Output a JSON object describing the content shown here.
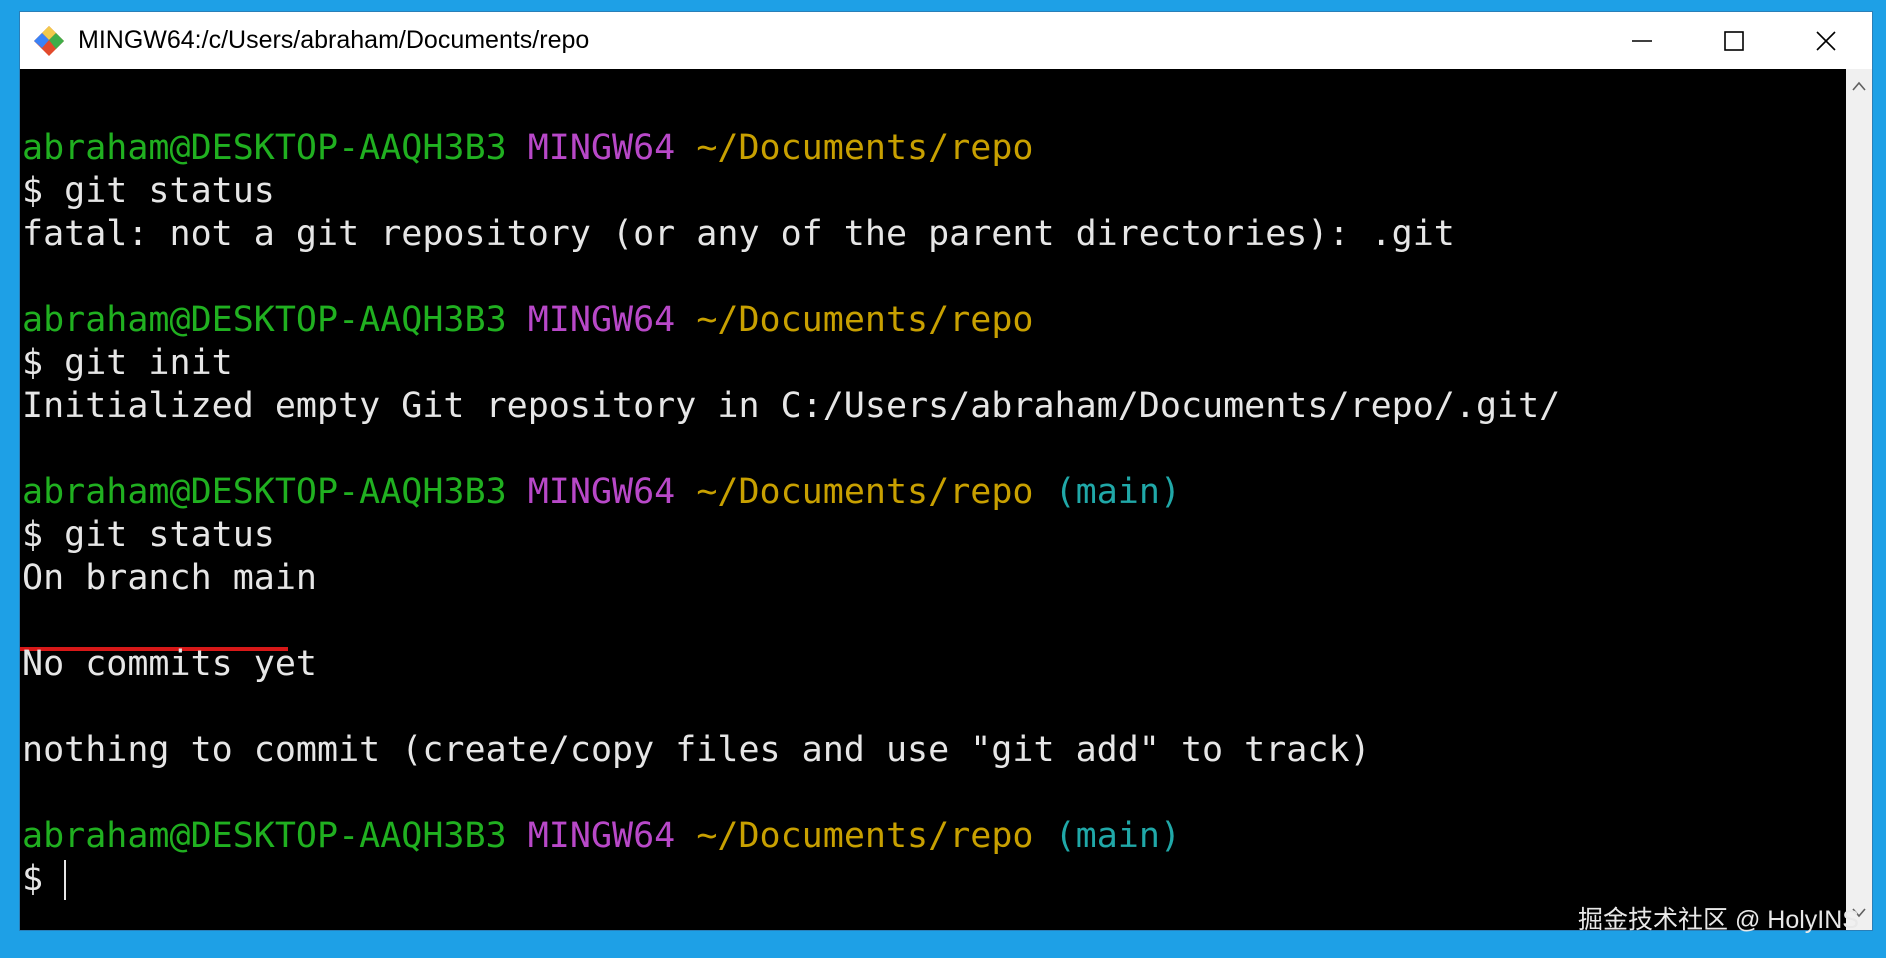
{
  "window": {
    "title": "MINGW64:/c/Users/abraham/Documents/repo",
    "app_icon": "git-bash-icon",
    "controls": [
      "minimize-icon",
      "maximize-icon",
      "close-icon"
    ]
  },
  "terminal": {
    "prompts": [
      {
        "user": "abraham@DESKTOP-AAQH3B3",
        "sys": "MINGW64",
        "path": "~/Documents/repo",
        "branch": ""
      },
      {
        "user": "abraham@DESKTOP-AAQH3B3",
        "sys": "MINGW64",
        "path": "~/Documents/repo",
        "branch": ""
      },
      {
        "user": "abraham@DESKTOP-AAQH3B3",
        "sys": "MINGW64",
        "path": "~/Documents/repo",
        "branch": "(main)"
      },
      {
        "user": "abraham@DESKTOP-AAQH3B3",
        "sys": "MINGW64",
        "path": "~/Documents/repo",
        "branch": "(main)"
      }
    ],
    "commands": [
      "$ git status",
      "$ git init",
      "$ git status",
      "$ "
    ],
    "outputs": [
      "fatal: not a git repository (or any of the parent directories): .git",
      "Initialized empty Git repository in C:/Users/abraham/Documents/repo/.git/",
      "On branch main",
      "No commits yet",
      "nothing to commit (create/copy files and use \"git add\" to track)"
    ],
    "colors": {
      "background": "#000000",
      "text": "#e6e6e6",
      "user": "#20b020",
      "sys": "#b848c8",
      "path": "#c8a000",
      "branch": "#20a8a8",
      "highlight_underline": "#d81818"
    }
  },
  "watermark": "掘金技术社区 @ HolyINS"
}
